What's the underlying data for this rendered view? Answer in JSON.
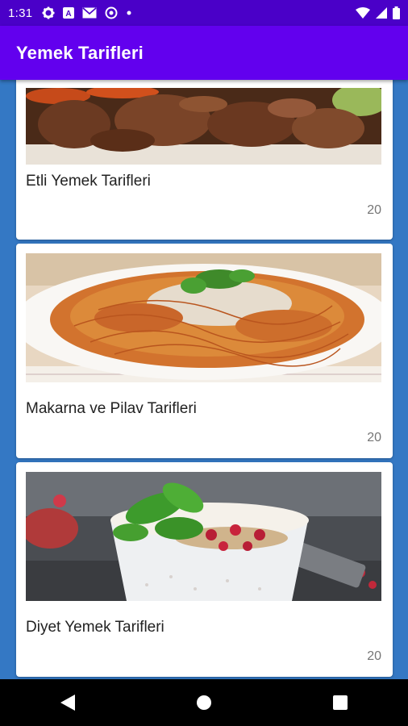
{
  "status_bar": {
    "time": "1:31",
    "left_icons": [
      "gear-icon",
      "a-icon",
      "mail-icon",
      "circle-icon",
      "dot-icon"
    ],
    "right_icons": [
      "wifi-icon",
      "signal-icon",
      "battery-icon"
    ]
  },
  "app_bar": {
    "title": "Yemek Tarifleri",
    "color": "#6200ee"
  },
  "categories": [
    {
      "title": "Etli Yemek Tarifleri",
      "count": "20",
      "image": "meat-dish-photo"
    },
    {
      "title": "Makarna ve Pilav Tarifleri",
      "count": "20",
      "image": "spaghetti-photo"
    },
    {
      "title": "Diyet Yemek Tarifleri",
      "count": "20",
      "image": "yogurt-bowl-photo"
    }
  ],
  "nav_bar": {
    "buttons": [
      "back-icon",
      "home-icon",
      "recents-icon"
    ]
  },
  "colors": {
    "status_bar": "#4a00c8",
    "background": "#3478c4"
  }
}
